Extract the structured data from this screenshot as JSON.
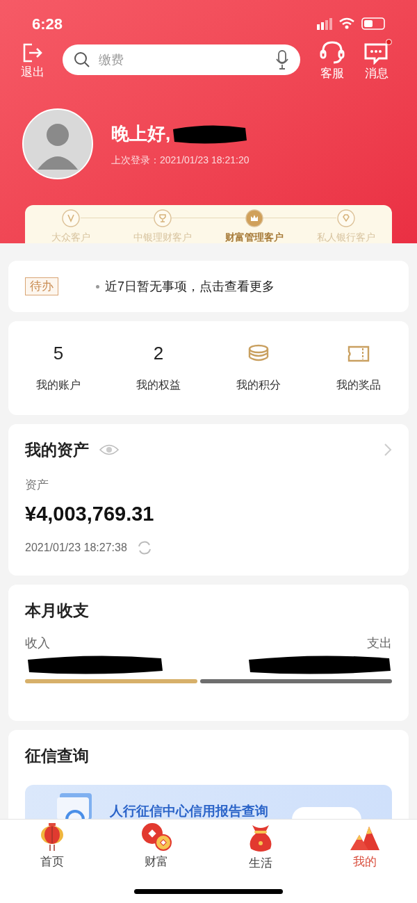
{
  "status_bar": {
    "time": "6:28"
  },
  "top_bar": {
    "logout_label": "退出",
    "search": {
      "placeholder": "缴费"
    },
    "actions": [
      {
        "label": "客服",
        "kind": "headset",
        "badge": false
      },
      {
        "label": "消息",
        "kind": "message",
        "badge": true
      }
    ]
  },
  "profile": {
    "greeting": "晚上好,",
    "last_login": "上次登录：2021/01/23 18:21:20"
  },
  "tiers": [
    {
      "label": "大众客户",
      "kind": "v",
      "selected": false
    },
    {
      "label": "中银理财客户",
      "kind": "trophy",
      "selected": false
    },
    {
      "label": "财富管理客户",
      "kind": "crown",
      "selected": true
    },
    {
      "label": "私人银行客户",
      "kind": "diamond",
      "selected": false
    }
  ],
  "todo": {
    "tag": "待办",
    "text": "近7日暂无事项，点击查看更多"
  },
  "shortcuts": [
    {
      "kind": "count",
      "value": "5",
      "label": "我的账户"
    },
    {
      "kind": "count",
      "value": "2",
      "label": "我的权益"
    },
    {
      "kind": "coins",
      "label": "我的积分"
    },
    {
      "kind": "ticket",
      "label": "我的奖品"
    }
  ],
  "assets": {
    "title": "我的资产",
    "label": "资产",
    "amount": "¥4,003,769.31",
    "updated": "2021/01/23 18:27:38"
  },
  "monthly": {
    "title": "本月收支",
    "income_label": "收入",
    "expense_label": "支出",
    "level": 0.47
  },
  "credit": {
    "title": "征信查询",
    "banner_text": "人行征信中心信用报告查询"
  },
  "tab_bar": [
    {
      "label": "首页",
      "kind": "lantern",
      "selected": false
    },
    {
      "label": "财富",
      "kind": "coins",
      "selected": false
    },
    {
      "label": "生活",
      "kind": "bag",
      "selected": false
    },
    {
      "label": "我的",
      "kind": "mountain",
      "selected": true
    }
  ]
}
